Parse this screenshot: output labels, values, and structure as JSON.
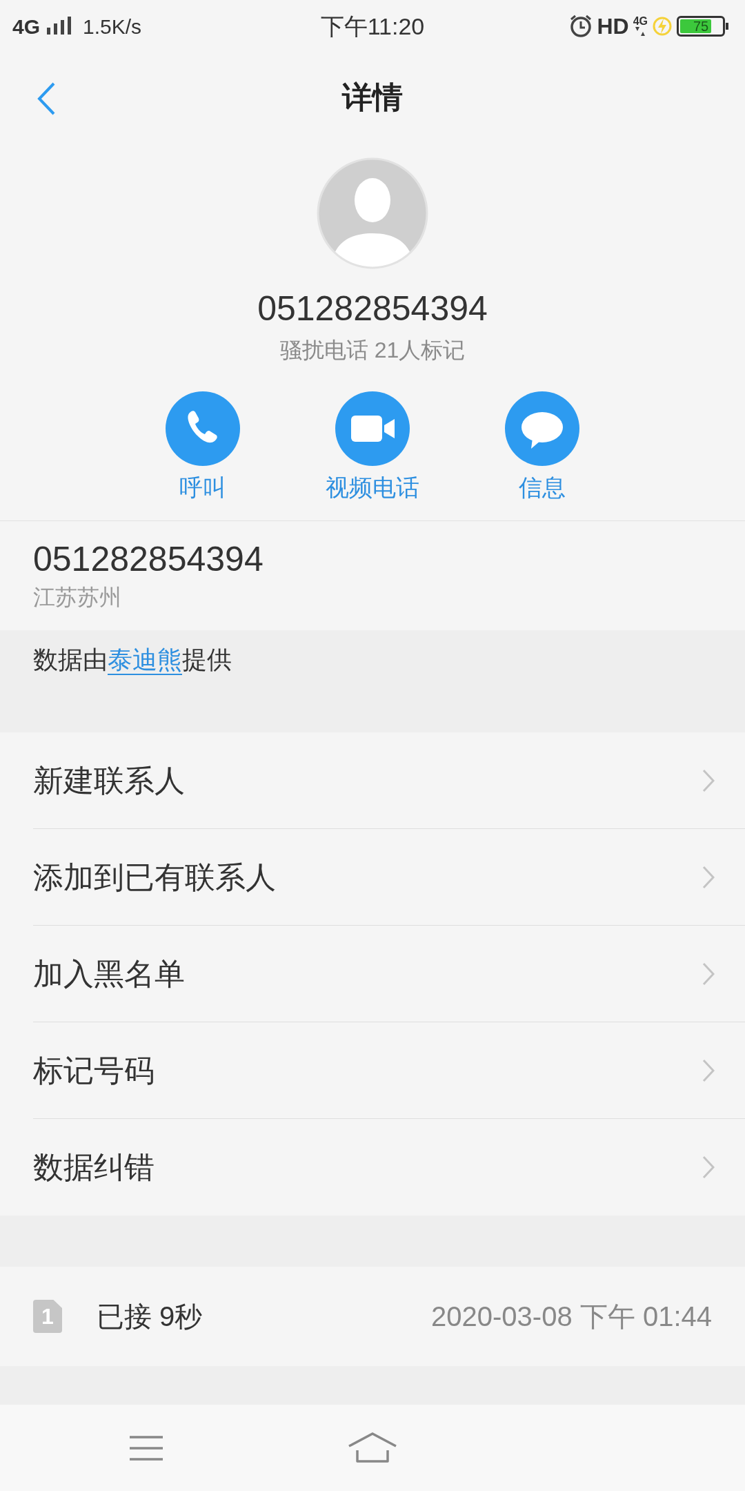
{
  "status_bar": {
    "network": "4G",
    "speed": "1.5K/s",
    "time": "下午11:20",
    "hd": "HD",
    "network_small": "4G",
    "battery": "75"
  },
  "header": {
    "title": "详情"
  },
  "contact": {
    "number": "051282854394",
    "tag": "骚扰电话 21人标记"
  },
  "actions": [
    {
      "kind": "call",
      "label": "呼叫"
    },
    {
      "kind": "video",
      "label": "视频电话"
    },
    {
      "kind": "message",
      "label": "信息"
    }
  ],
  "info": {
    "number": "051282854394",
    "location": "江苏苏州"
  },
  "source": {
    "prefix": "数据由",
    "link": "泰迪熊",
    "suffix": "提供"
  },
  "menu": [
    {
      "label": "新建联系人"
    },
    {
      "label": "添加到已有联系人"
    },
    {
      "label": "加入黑名单"
    },
    {
      "label": "标记号码"
    },
    {
      "label": "数据纠错"
    }
  ],
  "call_log": [
    {
      "sim": "1",
      "status": "已接 9秒",
      "time": "2020-03-08 下午 01:44"
    }
  ]
}
